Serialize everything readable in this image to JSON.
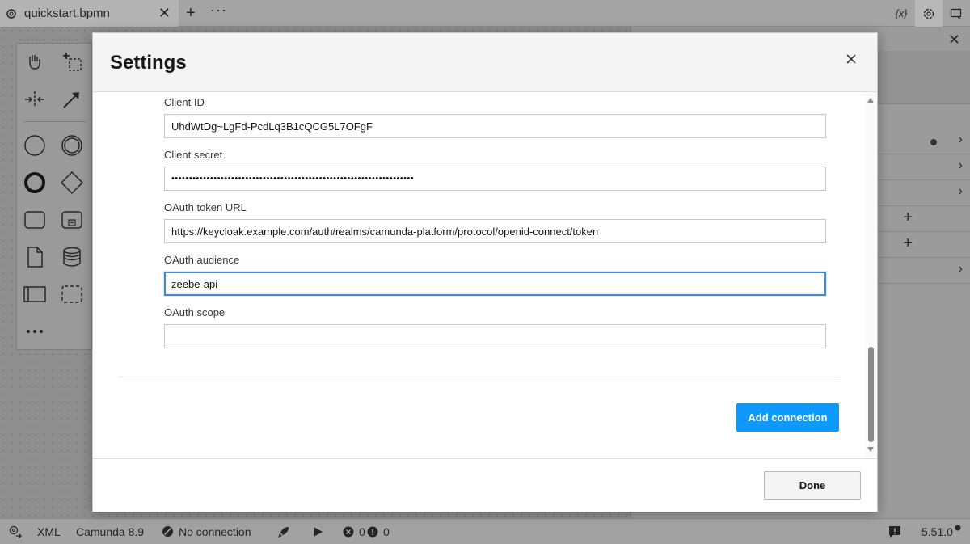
{
  "tab": {
    "title": "quickstart.bpmn"
  },
  "top_icons": {
    "variables_label": "{x}"
  },
  "modal": {
    "title": "Settings",
    "fields": [
      {
        "label": "Client ID",
        "value": "UhdWtDg~LgFd-PcdLq3B1cQCG5L7OFgF"
      },
      {
        "label": "Client secret",
        "value": "•••••••••••••••••••••••••••••••••••••••••••••••••••••••••••••••••••••"
      },
      {
        "label": "OAuth token URL",
        "value": "https://keycloak.example.com/auth/realms/camunda-platform/protocol/openid-connect/token"
      },
      {
        "label": "OAuth audience",
        "value": "zeebe-api"
      },
      {
        "label": "OAuth scope",
        "value": ""
      }
    ],
    "add_connection_label": "Add connection",
    "done_label": "Done"
  },
  "statusbar": {
    "xml_label": "XML",
    "engine_label": "Camunda 8.9",
    "connection_label": "No connection",
    "errors_count": "0",
    "warnings_count": "0",
    "version": "5.51.0"
  },
  "colors": {
    "primary_button": "#0d99ff",
    "focus_border": "#3c8ad8"
  }
}
